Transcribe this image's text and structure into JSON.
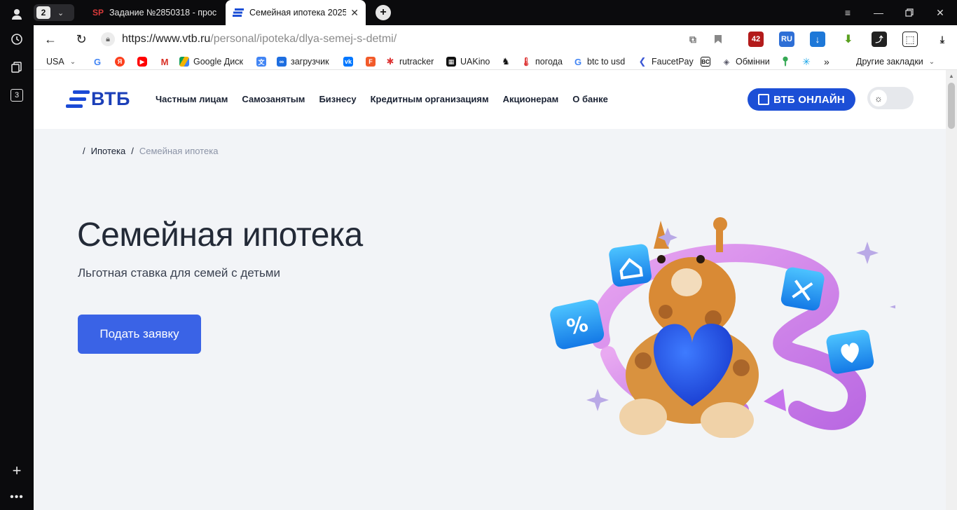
{
  "browser": {
    "tab_count": "2",
    "tabs": [
      {
        "favicon": "SP",
        "title": "Задание №2850318 - прос"
      },
      {
        "favicon": "vtb-icon",
        "title": "Семейная ипотека 2025"
      }
    ],
    "url_host": "https://www.vtb.ru",
    "url_path": "/personal/ipoteka/dlya-semej-s-detmi/",
    "sidebar_badge": "3",
    "bookmarks": [
      {
        "label": "USA",
        "icon": "none"
      },
      {
        "label": "",
        "icon": "google-icon"
      },
      {
        "label": "",
        "icon": "yandex-icon"
      },
      {
        "label": "",
        "icon": "youtube-icon"
      },
      {
        "label": "",
        "icon": "gmail-icon"
      },
      {
        "label": "Google Диск",
        "icon": "drive-icon"
      },
      {
        "label": "",
        "icon": "translate-icon"
      },
      {
        "label": "загрузчик",
        "icon": "loader-icon"
      },
      {
        "label": "",
        "icon": "vk-icon"
      },
      {
        "label": "",
        "icon": "f-icon"
      },
      {
        "label": "rutracker",
        "icon": "rutracker-icon"
      },
      {
        "label": "UAKino",
        "icon": "uakino-icon"
      },
      {
        "label": "",
        "icon": "chess-icon"
      },
      {
        "label": "погода",
        "icon": "thermometer-icon"
      },
      {
        "label": "btc to usd",
        "icon": "google-icon"
      },
      {
        "label": "FaucetPay",
        "icon": "faucetpay-icon"
      },
      {
        "label": "",
        "icon": "bc-icon"
      },
      {
        "label": "Обмінни",
        "icon": "exchange-icon"
      },
      {
        "label": "",
        "icon": "maps-icon"
      },
      {
        "label": "",
        "icon": "star-icon"
      }
    ],
    "bookmarks_more": "»",
    "other_bookmarks": "Другие закладки"
  },
  "site": {
    "logo_text": "ВТБ",
    "nav": [
      "Частным лицам",
      "Самозанятым",
      "Бизнесу",
      "Кредитным организациям",
      "Акционерам",
      "О банке"
    ],
    "online_button": "ВТБ ОНЛАЙН",
    "breadcrumb": {
      "sep": "/",
      "parent": "Ипотека",
      "current": "Семейная ипотека"
    },
    "hero": {
      "title": "Семейная ипотека",
      "subtitle": "Льготная ставка для семей с детьми",
      "cta": "Подать заявку"
    }
  },
  "colors": {
    "brand_blue": "#1c4fd6",
    "cta_blue": "#3a63e6",
    "page_bg": "#f2f4f7"
  }
}
